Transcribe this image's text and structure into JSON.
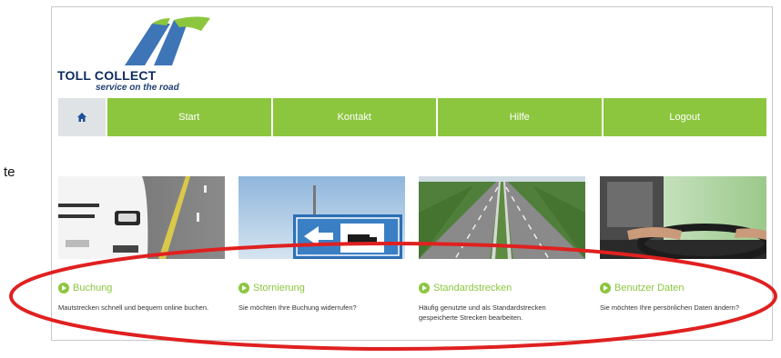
{
  "page": {
    "side_text": "te"
  },
  "logo": {
    "title": "TOLL COLLECT",
    "subtitle": "service on the road",
    "colors": {
      "blue": "#3e75b6",
      "green": "#8cc63f"
    }
  },
  "nav": {
    "home_icon": "home-icon",
    "items": [
      {
        "label": "Start"
      },
      {
        "label": "Kontakt"
      },
      {
        "label": "Hilfe"
      },
      {
        "label": "Logout"
      }
    ],
    "color": "#8cc63f"
  },
  "cards": [
    {
      "title": "Buchung",
      "description": "Mautstrecken schnell und bequem online buchen."
    },
    {
      "title": "Stornierung",
      "description": "Sie möchten Ihre Buchung widerrufen?"
    },
    {
      "title": "Standardstrecken",
      "description": "Häufig genutzte und als Standardstrecken gespeicherte Strecken bearbeiten."
    },
    {
      "title": "Benutzer Daten",
      "description": "Sie möchten Ihre persönlichen Daten ändern?"
    }
  ],
  "annotation": {
    "color": "#e02020"
  }
}
